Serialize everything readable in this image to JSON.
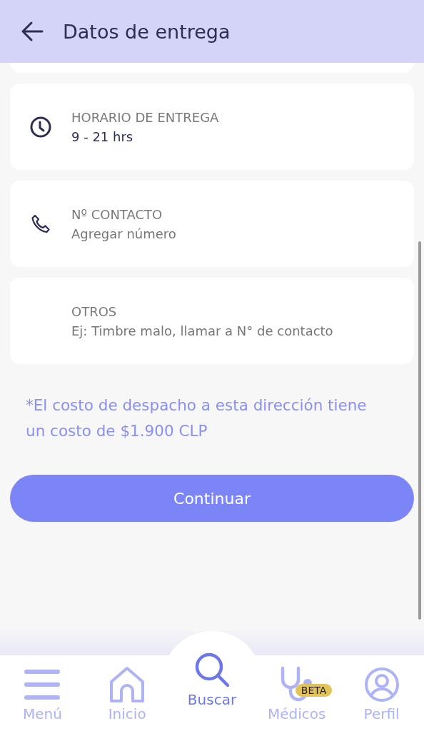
{
  "header": {
    "title": "Datos de entrega"
  },
  "fields": [
    {
      "kind": "clock",
      "label": "HORARIO DE ENTREGA",
      "value": "9 - 21 hrs"
    },
    {
      "kind": "phone",
      "label": "Nº CONTACTO",
      "placeholder": "Agregar número"
    },
    {
      "kind": "plain",
      "label": "OTROS",
      "placeholder": "Ej: Timbre malo, llamar a N° de contacto"
    }
  ],
  "note": "*El costo de despacho a esta dirección tiene un costo de $1.900 CLP",
  "button": "Continuar",
  "nav": [
    {
      "kind": "menu",
      "label": "Menú",
      "selected": false
    },
    {
      "kind": "home",
      "label": "Inicio",
      "selected": false
    },
    {
      "kind": "search",
      "label": "Buscar",
      "selected": true
    },
    {
      "kind": "doctors",
      "label": "Médicos",
      "selected": false,
      "badge": "BETA"
    },
    {
      "kind": "profile",
      "label": "Perfil",
      "selected": false
    }
  ]
}
